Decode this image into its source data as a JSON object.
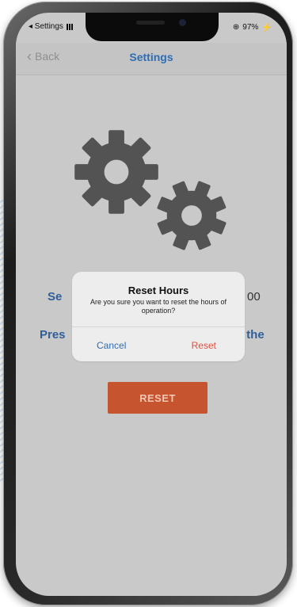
{
  "status_bar": {
    "carrier": "◂ Settings",
    "battery_percent": "97%"
  },
  "nav": {
    "back_label": "Back",
    "title": "Settings"
  },
  "content": {
    "line1_left": "Se",
    "line1_right": "00",
    "line2_left": "Pres",
    "line2_right": "t the",
    "reset_button": "RESET"
  },
  "alert": {
    "title": "Reset Hours",
    "message": "Are you sure you want to reset the hours of operation?",
    "cancel_label": "Cancel",
    "reset_label": "Reset"
  },
  "colors": {
    "accent_blue": "#2e6db4",
    "reset_orange": "#c5542f",
    "destructive_red": "#e14f3b"
  }
}
